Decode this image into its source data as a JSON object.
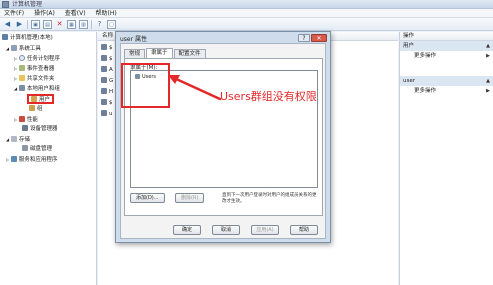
{
  "window": {
    "title": "计算机管理"
  },
  "menu": [
    "文件(F)",
    "操作(A)",
    "查看(V)",
    "帮助(H)"
  ],
  "tree": {
    "root": "计算机管理(本地)",
    "items": [
      {
        "label": "系统工具",
        "icon": "tools-icon",
        "level": 1
      },
      {
        "label": "任务计划程序",
        "icon": "clock-icon",
        "level": 2
      },
      {
        "label": "事件查看器",
        "icon": "log-icon",
        "level": 2
      },
      {
        "label": "共享文件夹",
        "icon": "folder-icon",
        "level": 2
      },
      {
        "label": "本地用户和组",
        "icon": "users-icon",
        "level": 2
      },
      {
        "label": "用户",
        "icon": "user-folder-icon",
        "level": 3,
        "selected": true
      },
      {
        "label": "组",
        "icon": "group-folder-icon",
        "level": 3
      },
      {
        "label": "性能",
        "icon": "perf-icon",
        "level": 2
      },
      {
        "label": "设备管理器",
        "icon": "device-icon",
        "level": 2
      },
      {
        "label": "存储",
        "icon": "storage-icon",
        "level": 1
      },
      {
        "label": "磁盘管理",
        "icon": "disk-icon",
        "level": 2
      },
      {
        "label": "服务和应用程序",
        "icon": "services-icon",
        "level": 1
      }
    ]
  },
  "content": {
    "column_header": "名称",
    "rows": [
      "$",
      "$",
      "A",
      "G",
      "H",
      "$",
      "u"
    ]
  },
  "actions": {
    "header": "操作",
    "sections": [
      {
        "title": "用户",
        "items": [
          "更多操作"
        ]
      },
      {
        "title": "user",
        "items": [
          "更多操作"
        ]
      }
    ]
  },
  "dialog": {
    "title": "user 属性",
    "help_button": "?",
    "close_button": "✕",
    "tabs": [
      "常规",
      "隶属于",
      "配置文件"
    ],
    "active_tab": 1,
    "member_label": "隶属于(M):",
    "members": [
      "Users"
    ],
    "add_button": "添加(D)...",
    "remove_button": "删除(R)",
    "note": "直到下一次用户登录时对用户的组成员关系的更改才生效。",
    "ok_button": "确定",
    "cancel_button": "取消",
    "apply_button": "应用(A)",
    "help_text_button": "帮助"
  },
  "annotation": {
    "text": "Users群组没有权限",
    "color": "#e22828"
  }
}
